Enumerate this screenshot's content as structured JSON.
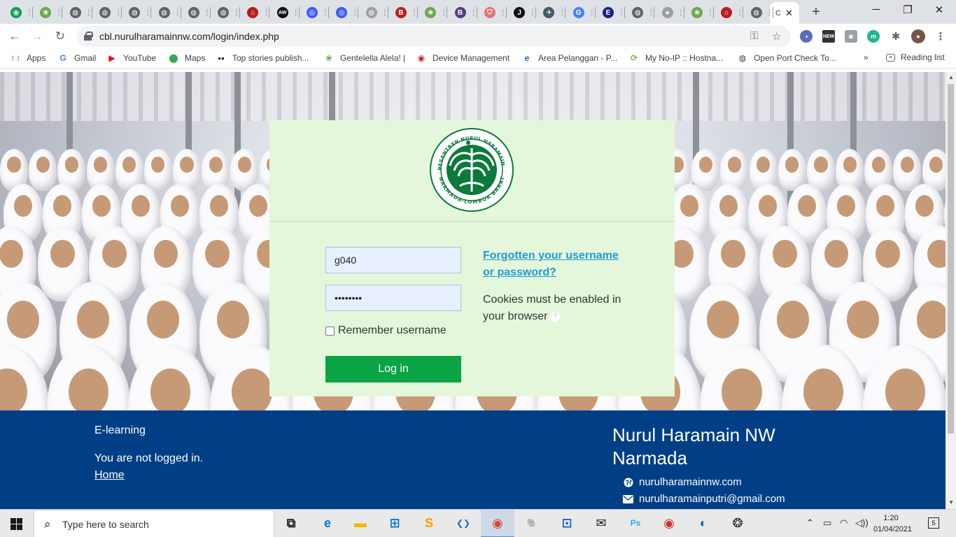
{
  "browser": {
    "active_tab": {
      "title": "C",
      "close": "✕"
    },
    "new_tab": "+",
    "window": {
      "minimize": "─",
      "maximize": "❐",
      "close": "✕"
    },
    "url": "cbl.nurulharamainnw.com/login/index.php",
    "tabs": [
      {
        "icon": "green-circle-icon",
        "color": "#0f9d58",
        "glyph": "◉"
      },
      {
        "icon": "school-logo-icon",
        "color": "#6aa84f",
        "glyph": "❀"
      },
      {
        "icon": "globe-icon",
        "color": "#5f6368",
        "glyph": "◍"
      },
      {
        "icon": "globe-icon",
        "color": "#5f6368",
        "glyph": "◍"
      },
      {
        "icon": "globe-icon",
        "color": "#5f6368",
        "glyph": "◍"
      },
      {
        "icon": "globe-icon",
        "color": "#5f6368",
        "glyph": "◍"
      },
      {
        "icon": "globe-icon",
        "color": "#5f6368",
        "glyph": "◍"
      },
      {
        "icon": "globe-icon",
        "color": "#5f6368",
        "glyph": "◍"
      },
      {
        "icon": "house-icon",
        "color": "#b71c1c",
        "glyph": "⌂"
      },
      {
        "icon": "aw-icon",
        "color": "#111111",
        "glyph": "AW"
      },
      {
        "icon": "blue-square-icon",
        "color": "#3d5afe",
        "glyph": "◎"
      },
      {
        "icon": "blue-square-icon",
        "color": "#3d5afe",
        "glyph": "◎"
      },
      {
        "icon": "globe-icon",
        "color": "#9e9e9e",
        "glyph": "◍"
      },
      {
        "icon": "b-icon",
        "color": "#b71c1c",
        "glyph": "B"
      },
      {
        "icon": "school-logo-icon",
        "color": "#6aa84f",
        "glyph": "❀"
      },
      {
        "icon": "bootstrap-icon",
        "color": "#563d7c",
        "glyph": "B"
      },
      {
        "icon": "shield-icon",
        "color": "#e57373",
        "glyph": "⛉"
      },
      {
        "icon": "j-icon",
        "color": "#111111",
        "glyph": "J"
      },
      {
        "icon": "paper-plane-icon",
        "color": "#455a64",
        "glyph": "✈"
      },
      {
        "icon": "google-icon",
        "color": "#4285f4",
        "glyph": "G"
      },
      {
        "icon": "e-icon",
        "color": "#1a237e",
        "glyph": "E"
      },
      {
        "icon": "globe-icon",
        "color": "#5f6368",
        "glyph": "◍"
      },
      {
        "icon": "apple-icon",
        "color": "#9e9e9e",
        "glyph": "●"
      },
      {
        "icon": "school-logo-icon",
        "color": "#6aa84f",
        "glyph": "❀"
      },
      {
        "icon": "house-icon",
        "color": "#b71c1c",
        "glyph": "⌂"
      },
      {
        "icon": "globe-icon",
        "color": "#5f6368",
        "glyph": "◍"
      }
    ]
  },
  "bookmarks": [
    {
      "label": "Apps",
      "icon": "apps-grid-icon",
      "color": "#ea4335",
      "glyph": "⋮⋮"
    },
    {
      "label": "Gmail",
      "icon": "google-icon",
      "color": "#4285f4",
      "glyph": "G"
    },
    {
      "label": "YouTube",
      "icon": "youtube-icon",
      "color": "#ff0000",
      "glyph": "▶"
    },
    {
      "label": "Maps",
      "icon": "maps-pin-icon",
      "color": "#34a853",
      "glyph": "⬤"
    },
    {
      "label": "Top stories publish...",
      "icon": "medium-icon",
      "color": "#111111",
      "glyph": "●●"
    },
    {
      "label": "Gentelella Alela! |",
      "icon": "school-logo-icon",
      "color": "#6aa84f",
      "glyph": "❀"
    },
    {
      "label": "Device Management",
      "icon": "target-icon",
      "color": "#c62828",
      "glyph": "◉"
    },
    {
      "label": "Area Pelanggan - P...",
      "icon": "e-circle-icon",
      "color": "#1565c0",
      "glyph": "e"
    },
    {
      "label": "My No-IP :: Hostna...",
      "icon": "noip-icon",
      "color": "#7cb342",
      "glyph": "⟳"
    },
    {
      "label": "Open Port Check To...",
      "icon": "globe-icon",
      "color": "#424242",
      "glyph": "◍"
    }
  ],
  "bookmarks_more": "»",
  "reading_list": "Reading list",
  "login": {
    "username_value": "g040",
    "password_value": "••••••••",
    "remember_label": "Remember username",
    "login_button": "Log in",
    "forgot_link": "Forgotten your username or password?",
    "cookies_notice": "Cookies must be enabled in your browser",
    "help_glyph": "?",
    "logo_text_top": "PONDOK PESANTREN NURUL HARAMAIN PUTRI NW",
    "logo_text_bottom": "NARMADA-LOMBOK BARAT"
  },
  "footer": {
    "elearning": "E-learning",
    "not_logged_in": "You are not logged in.",
    "home_link": "Home",
    "title_line1": "Nurul Haramain NW",
    "title_line2": "Narmada",
    "website": "nurulharamainnw.com",
    "email": "nurulharamainputri@gmail.com"
  },
  "taskbar": {
    "search_placeholder": "Type here to search",
    "time": "1:20",
    "date": "01/04/2021",
    "notifications": "5",
    "apps": [
      {
        "icon": "task-view-icon",
        "glyph": "⧉",
        "color": "#222222"
      },
      {
        "icon": "edge-icon",
        "glyph": "e",
        "color": "#0078d7"
      },
      {
        "icon": "file-explorer-icon",
        "glyph": "▬",
        "color": "#f2b705"
      },
      {
        "icon": "store-icon",
        "glyph": "⊞",
        "color": "#0078d7"
      },
      {
        "icon": "sublime-icon",
        "glyph": "S",
        "color": "#ff9800"
      },
      {
        "icon": "vscode-icon",
        "glyph": "❮❯",
        "color": "#0078d7"
      },
      {
        "icon": "chrome-icon",
        "glyph": "◉",
        "color": "#db4437"
      },
      {
        "icon": "postgres-icon",
        "glyph": "🐘",
        "color": "#336791"
      },
      {
        "icon": "network-icon",
        "glyph": "⊡",
        "color": "#1565c0"
      },
      {
        "icon": "mail-icon",
        "glyph": "✉",
        "color": "#222222"
      },
      {
        "icon": "photoshop-icon",
        "glyph": "Ps",
        "color": "#31a8ff"
      },
      {
        "icon": "red-app-icon",
        "glyph": "◉",
        "color": "#d32f2f"
      },
      {
        "icon": "bluetooth-app-icon",
        "glyph": "◐",
        "color": "#1565c0"
      },
      {
        "icon": "dog-icon",
        "glyph": "❂",
        "color": "#222222"
      }
    ]
  }
}
